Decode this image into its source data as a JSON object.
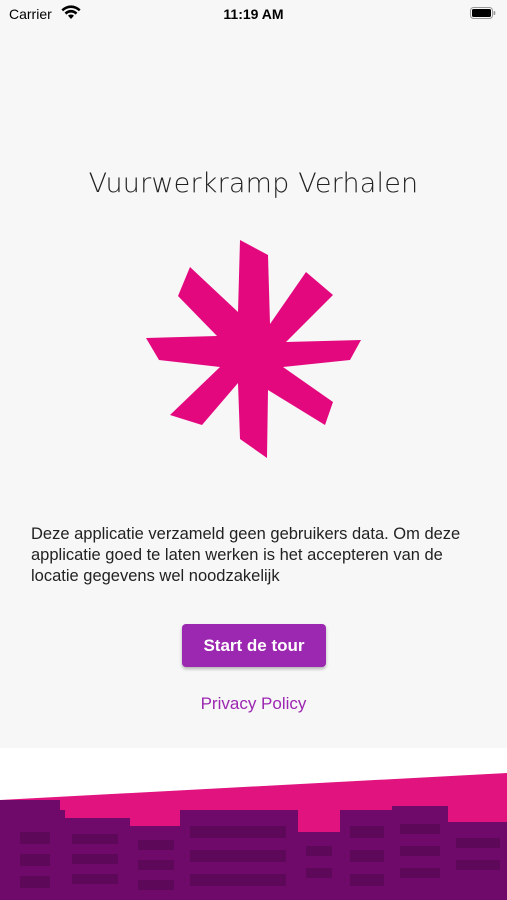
{
  "status_bar": {
    "carrier": "Carrier",
    "time": "11:19 AM",
    "wifi_icon": "wifi-icon",
    "battery_icon": "battery-icon"
  },
  "main": {
    "title": "Vuurwerkramp Verhalen",
    "logo_icon": "asterisk-star-logo",
    "description": "Deze applicatie verzameld geen gebruikers data. Om deze applicatie goed te laten werken is het accepteren van de locatie gegevens wel noodzakelijk",
    "start_button_label": "Start de tour",
    "privacy_link_label": "Privacy Policy"
  },
  "footer": {
    "illustration": "city-skyline-illustration"
  },
  "colors": {
    "accent_purple": "#9c27b0",
    "logo_pink": "#e4087f",
    "skyline_purple": "#6f0a6a",
    "background": "#f7f7f8"
  }
}
